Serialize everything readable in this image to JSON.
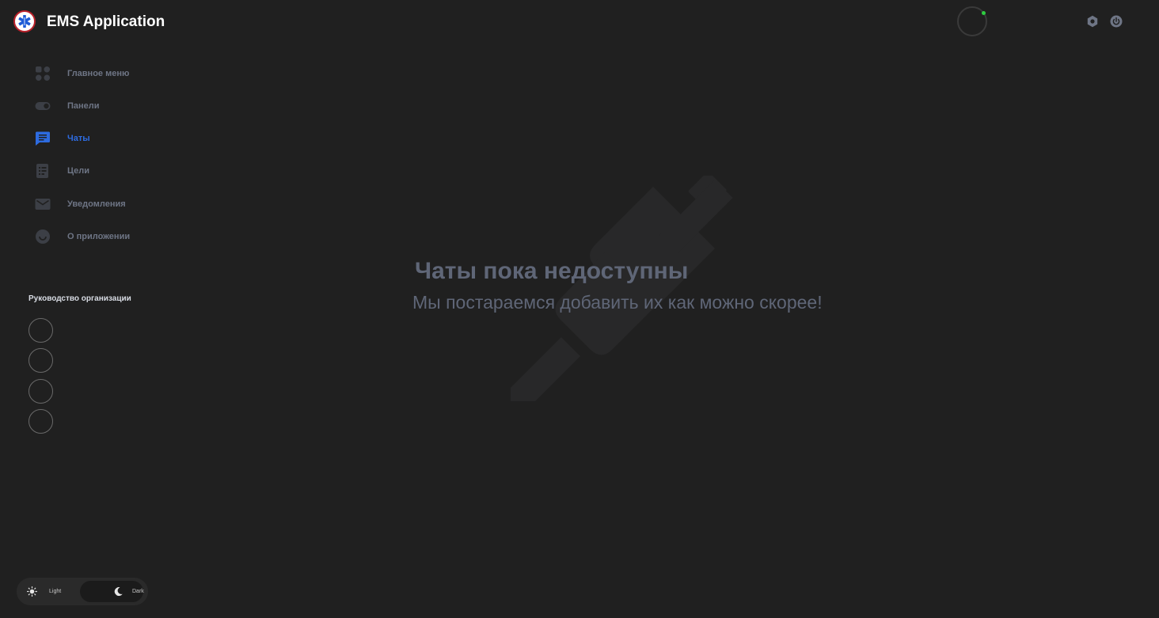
{
  "header": {
    "app_title": "EMS Application",
    "logo_icon": "star-of-life-icon",
    "status_color": "#2ecc40",
    "settings_icon": "settings-icon",
    "power_icon": "power-icon"
  },
  "sidebar": {
    "items": [
      {
        "label": "Главное меню",
        "icon": "grid-icon",
        "active": false
      },
      {
        "label": "Панели",
        "icon": "toggle-icon",
        "active": false
      },
      {
        "label": "Чаты",
        "icon": "chat-icon",
        "active": true
      },
      {
        "label": "Цели",
        "icon": "checklist-icon",
        "active": false
      },
      {
        "label": "Уведомления",
        "icon": "mail-icon",
        "active": false
      },
      {
        "label": "О приложении",
        "icon": "info-icon",
        "active": false
      }
    ],
    "leadership_title": "Руководство организации",
    "accent_color": "#2d6be0"
  },
  "main": {
    "empty_title": "Чаты пока недоступны",
    "empty_subtitle": "Мы постараемся добавить их как можно скорее!",
    "background_icon": "unplugged-icon"
  },
  "theme": {
    "light_label": "Light",
    "dark_label": "Dark",
    "selected": "dark"
  }
}
